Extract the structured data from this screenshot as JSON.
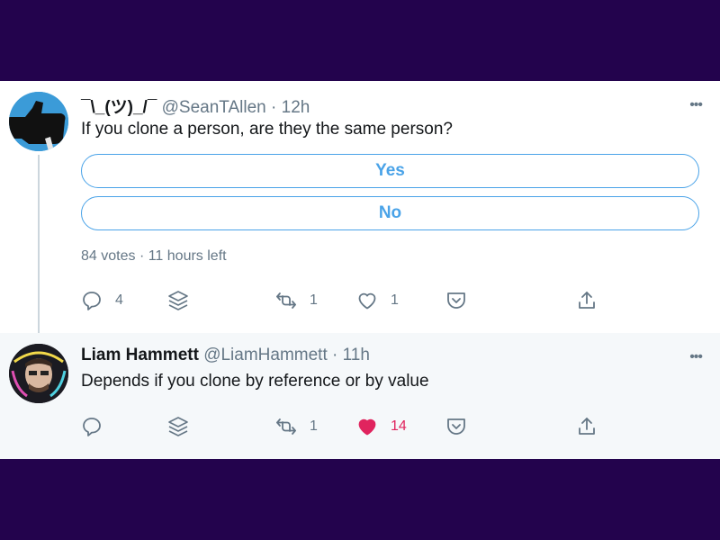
{
  "tweets": [
    {
      "name": "¯\\_(ツ)_/¯",
      "handle": "@SeanTAllen",
      "separator": "·",
      "time": "12h",
      "text": "If you clone a person, are they the same person?",
      "poll": {
        "options": [
          "Yes",
          "No"
        ],
        "votes": "84 votes",
        "separator": "·",
        "time_left": "11 hours left"
      },
      "actions": {
        "replies": "4",
        "retweets": "1",
        "likes": "1"
      },
      "more_icon": "•••"
    },
    {
      "name": "Liam Hammett",
      "handle": "@LiamHammett",
      "separator": "·",
      "time": "11h",
      "text": "Depends if you clone by reference or by value",
      "actions": {
        "replies": "",
        "retweets": "1",
        "likes": "14"
      },
      "more_icon": "•••"
    }
  ],
  "colors": {
    "background": "#23034d",
    "accent": "#4aa3e8",
    "like_active": "#e0245e",
    "muted": "#657786"
  },
  "icons": [
    "reply-icon",
    "layers-icon",
    "retweet-icon",
    "heart-icon",
    "pocket-icon",
    "share-icon"
  ]
}
